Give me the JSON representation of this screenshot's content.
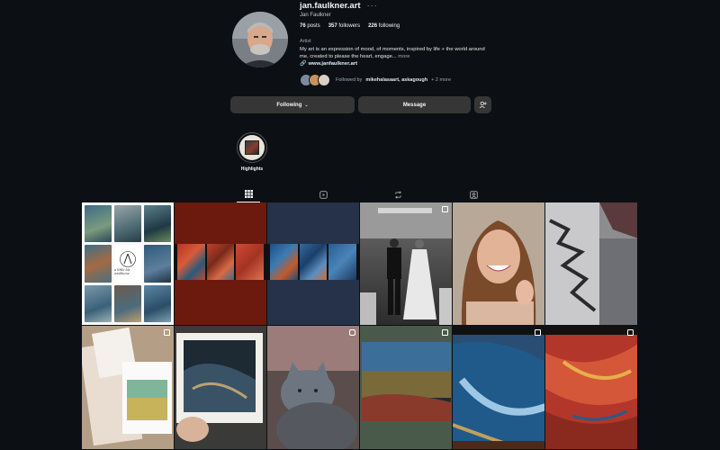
{
  "profile": {
    "username": "jan.faulkner.art",
    "more_dots": "···",
    "full_name": "Jan Faulkner",
    "stats": {
      "posts_count": "76",
      "posts_label": "posts",
      "followers_count": "357",
      "followers_label": "followers",
      "following_count": "226",
      "following_label": "following"
    },
    "category": "Artist",
    "bio": "My art is an expression of mood, of moments, inspired by life + the world around me, created to please the heart, engage...",
    "bio_more": "more",
    "link": "www.janfaulkner.art",
    "followed_by_prefix": "Followed by",
    "followed_by_names": "mikehalasaart, askagough",
    "followed_by_suffix": "+ 2 more"
  },
  "actions": {
    "following_label": "Following",
    "message_label": "Message"
  },
  "highlights": [
    {
      "label": "Highlights"
    }
  ],
  "tabs": [
    {
      "icon": "grid-icon",
      "active": true
    },
    {
      "icon": "reels-icon",
      "active": false
    },
    {
      "icon": "repost-icon",
      "active": false
    },
    {
      "icon": "tagged-icon",
      "active": false
    }
  ],
  "grid": {
    "collage_caption": "a little bit wishbone",
    "posts": [
      {
        "kind": "collage",
        "badge": "none"
      },
      {
        "kind": "red-triptych",
        "badge": "none"
      },
      {
        "kind": "blue-triptych",
        "badge": "none"
      },
      {
        "kind": "wedding-photo",
        "badge": "carousel"
      },
      {
        "kind": "selfie",
        "badge": "none"
      },
      {
        "kind": "grey-painting",
        "badge": "none"
      },
      {
        "kind": "card-and-envelope",
        "badge": "carousel"
      },
      {
        "kind": "framed-painting",
        "badge": "none"
      },
      {
        "kind": "cat-photo",
        "badge": "reel"
      },
      {
        "kind": "landscape-painting",
        "badge": "carousel"
      },
      {
        "kind": "blue-abstract",
        "badge": "carousel"
      },
      {
        "kind": "red-abstract",
        "badge": "carousel"
      }
    ]
  }
}
